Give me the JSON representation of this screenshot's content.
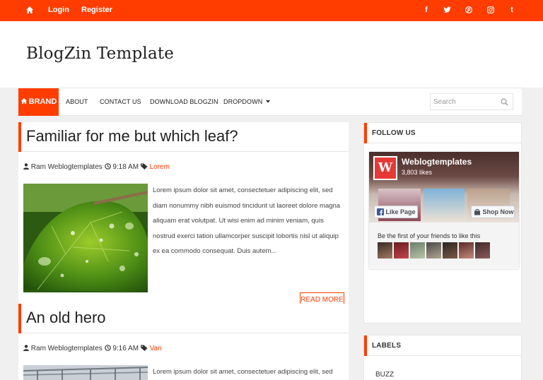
{
  "topbar": {
    "login": "Login",
    "register": "Register",
    "social": [
      "f",
      "t",
      "p",
      "i",
      "t"
    ],
    "color": "#ff3d00"
  },
  "header": {
    "title": "BlogZin Template"
  },
  "nav": {
    "brand": "BRAND",
    "items": [
      "ABOUT",
      "CONTACT US",
      "DOWNLOAD BLOGZIN",
      "DROPDOWN"
    ],
    "search_placeholder": "Search"
  },
  "posts": [
    {
      "title": "Familiar for me but which leaf?",
      "author": "Ram Weblogtemplates",
      "time": "9:18 AM",
      "tag": "Lorem",
      "excerpt": "Lorem ipsum dolor sit amet, consectetuer adipiscing elit, sed diam nonummy nibh euismod tincidunt ut laoreet dolore magna aliquam erat volutpat. Ut wisi enim ad minim veniam, quis nostrud exerci tation ullamcorper suscipit lobortis nisl ut aliquip ex ea commodo consequat. Duis autem...",
      "read_more": "READ MORE"
    },
    {
      "title": "An old hero",
      "author": "Ram Weblogtemplates",
      "time": "9:16 AM",
      "tag": "Van",
      "excerpt": "Lorem ipsum dolor sit amet, consectetuer adipiscing elit, sed"
    }
  ],
  "sidebar": {
    "follow_title": "FOLLOW US",
    "fb": {
      "page_name": "Weblogtemplates",
      "likes": "3,803 likes",
      "like_button": "Like Page",
      "shop_button": "Shop Now",
      "social_text": "Be the first of your friends to like this"
    },
    "labels_title": "LABELS",
    "labels": [
      "BUZZ"
    ]
  }
}
